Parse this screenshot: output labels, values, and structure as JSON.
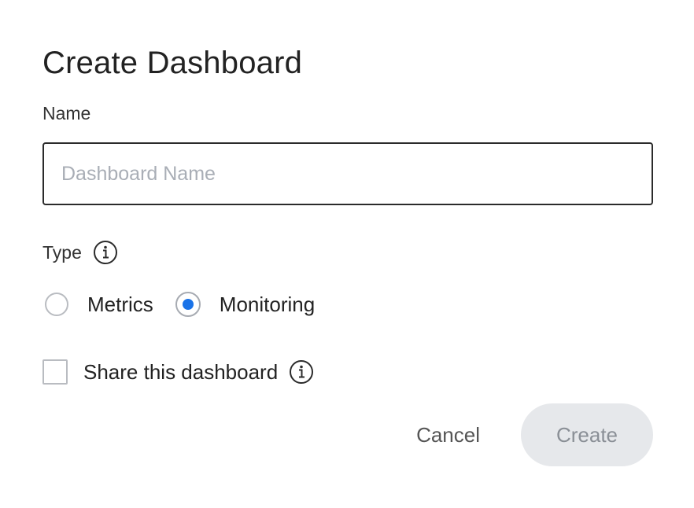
{
  "dialog": {
    "title": "Create Dashboard",
    "name_label": "Name",
    "name_value": "",
    "name_placeholder": "Dashboard Name",
    "type_label": "Type",
    "type_options": [
      {
        "label": "Metrics",
        "selected": false
      },
      {
        "label": "Monitoring",
        "selected": true
      }
    ],
    "share_label": "Share this dashboard",
    "share_checked": false,
    "cancel_label": "Cancel",
    "create_label": "Create",
    "create_enabled": false
  },
  "icons": {
    "type_info": "info-icon",
    "share_info": "info-icon"
  },
  "colors": {
    "accent": "#1a73e8",
    "create_disabled_bg": "#e6e8eb",
    "create_disabled_text": "#8a8f96"
  }
}
